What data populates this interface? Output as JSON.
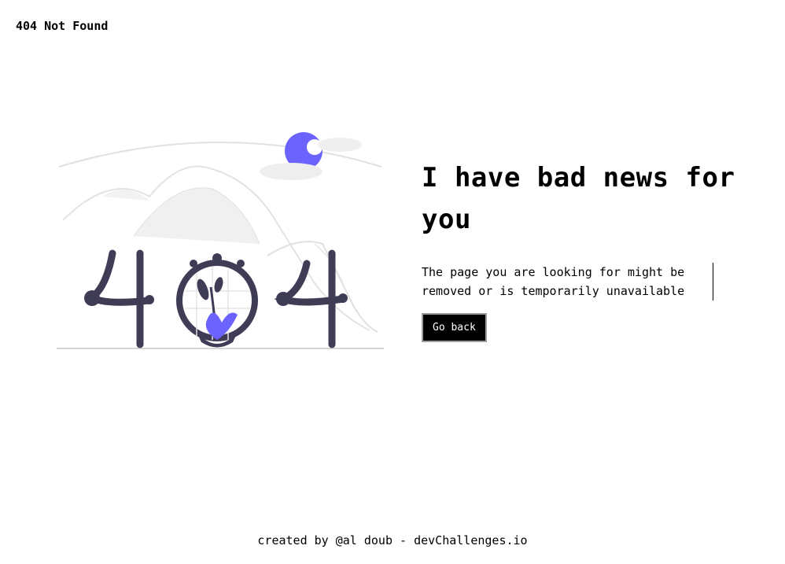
{
  "header": {
    "brand": "404 Not Found"
  },
  "main": {
    "headline": "I have bad news for you",
    "message": "The page you are looking for might be removed or is temporarily unavailable",
    "button_label": "Go back"
  },
  "footer": {
    "credit": "created by @al doub - devChallenges.io"
  },
  "colors": {
    "accent": "#6c63ff",
    "dark": "#3f3d56",
    "button_bg": "#000000",
    "button_border": "#9e9e9e"
  },
  "illustration": {
    "icon": "404-illustration"
  }
}
